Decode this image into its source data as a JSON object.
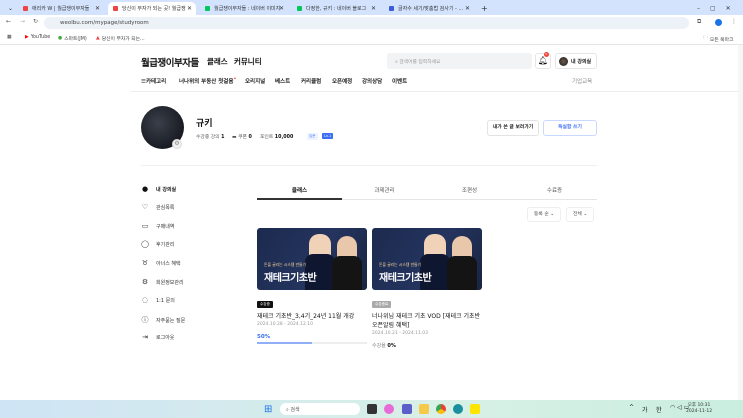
{
  "browser": {
    "tabs": [
      {
        "title": "애리카 W | 월급쟁이부자들"
      },
      {
        "title": "당신이 부자가 되는 곳! 월급쟁"
      },
      {
        "title": "월급쟁이부자들 : 네이버 이미지"
      },
      {
        "title": "다정한, 규키 : 네이버 블로그"
      },
      {
        "title": "글자수 세기/맞춤법 검사기 - ..."
      }
    ],
    "url": "weolbu.com/mypage/studyroom",
    "bookmarks": [
      "YouTube",
      "스마트(JM)",
      "당신이 부자가 되는..."
    ],
    "all_bookmarks": "모든 북마크"
  },
  "header": {
    "logo": "월급쟁이부자들",
    "menu": [
      "클래스",
      "커뮤니티"
    ],
    "search_placeholder": "검색어를 입력하세요",
    "notif_count": "0",
    "my_class": "내 강의실",
    "nav": [
      "카테고리",
      "너나위의 부동산 첫걸음",
      "오리지널",
      "베스트",
      "커리큘럼",
      "오픈예정",
      "강의상담",
      "이벤트"
    ],
    "corp": "기업교육"
  },
  "profile": {
    "name": "규키",
    "stats": [
      {
        "label": "수강중 강의",
        "value": "1"
      },
      {
        "label": "쿠폰",
        "value": "0"
      },
      {
        "label": "포인트",
        "value": "10,000"
      }
    ],
    "tags": [
      "입문",
      "Lv.1"
    ],
    "btn_posts": "내가 쓴 글 보러가기",
    "btn_write": "독실함 쓰기"
  },
  "sidebar": [
    "내 강의실",
    "관심목록",
    "구매내역",
    "후기관리",
    "아너스 혜택",
    "회원정보관리",
    "1:1 문의",
    "자주묻는 질문",
    "로그아웃"
  ],
  "tabs": [
    "클래스",
    "과제관리",
    "조편성",
    "수료증"
  ],
  "filters": [
    "등록 순",
    "전체"
  ],
  "courses": [
    {
      "thumb_sub": "돈을 굴리는 시스템 만들기",
      "thumb_title": "재테크기초반",
      "badge": "수강중",
      "title": "재테크 기초반_3,4기_24년 11월 개강",
      "date": "2024.10.28 - 2024.12.10",
      "progress_label": "50%",
      "progress": 50
    },
    {
      "thumb_sub": "돈을 굴리는 시스템 만들기",
      "thumb_title": "재테크기초반",
      "badge": "수강종료",
      "title": "너나위님 재테크 기초 VOD [재테크 기초반 오픈알림 혜택]",
      "date": "2024.10.21 - 2024.11.03",
      "rate_label": "수강율",
      "rate": "0%"
    }
  ],
  "taskbar": {
    "search": "검색",
    "time": "오후 10:31",
    "date": "2024-11-12",
    "ime": [
      "가",
      "한"
    ]
  }
}
